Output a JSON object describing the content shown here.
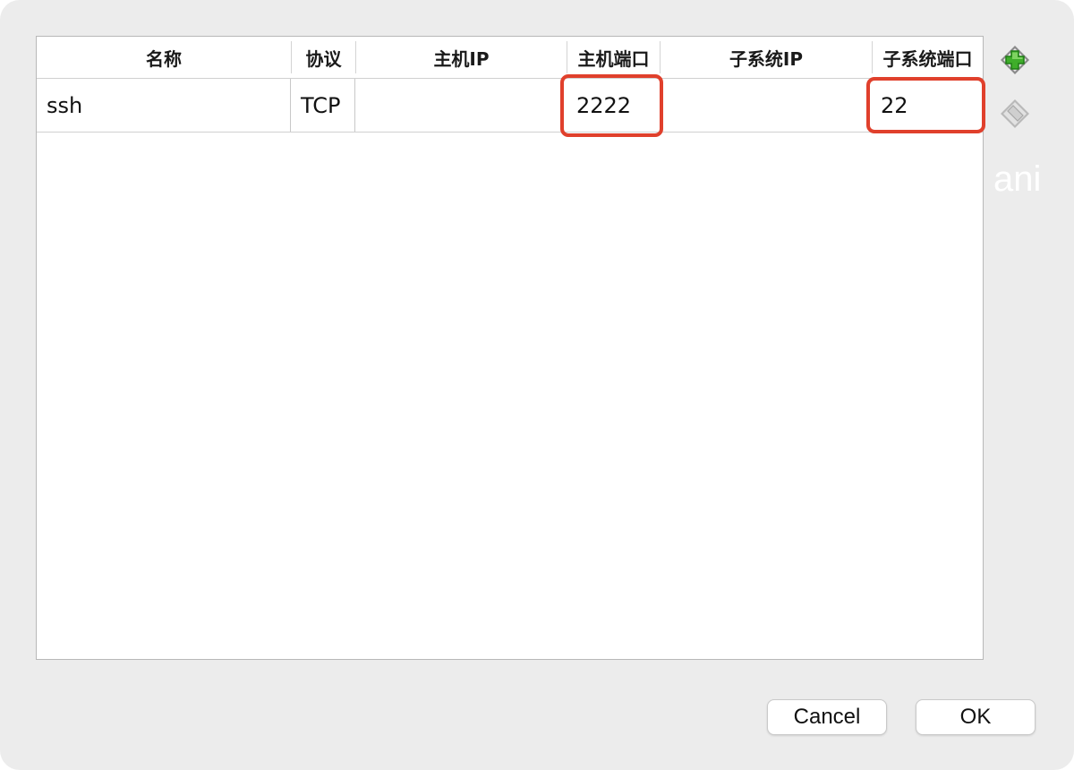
{
  "table": {
    "columns": [
      {
        "label": "名称"
      },
      {
        "label": "协议"
      },
      {
        "label": "主机IP"
      },
      {
        "label": "主机端口"
      },
      {
        "label": "子系统IP"
      },
      {
        "label": "子系统端口"
      }
    ],
    "rows": [
      {
        "name": "ssh",
        "protocol": "TCP",
        "host_ip": "",
        "host_port": "2222",
        "guest_ip": "",
        "guest_port": "22"
      }
    ]
  },
  "side_toolbar": {
    "add_icon": "add-rule-icon",
    "remove_icon": "remove-rule-icon"
  },
  "overlay_text": "ani",
  "buttons": {
    "cancel": "Cancel",
    "ok": "OK"
  },
  "colors": {
    "highlight": "#e0402c",
    "add_icon": "#3fae2a",
    "disabled_icon": "#b9b9b9"
  }
}
